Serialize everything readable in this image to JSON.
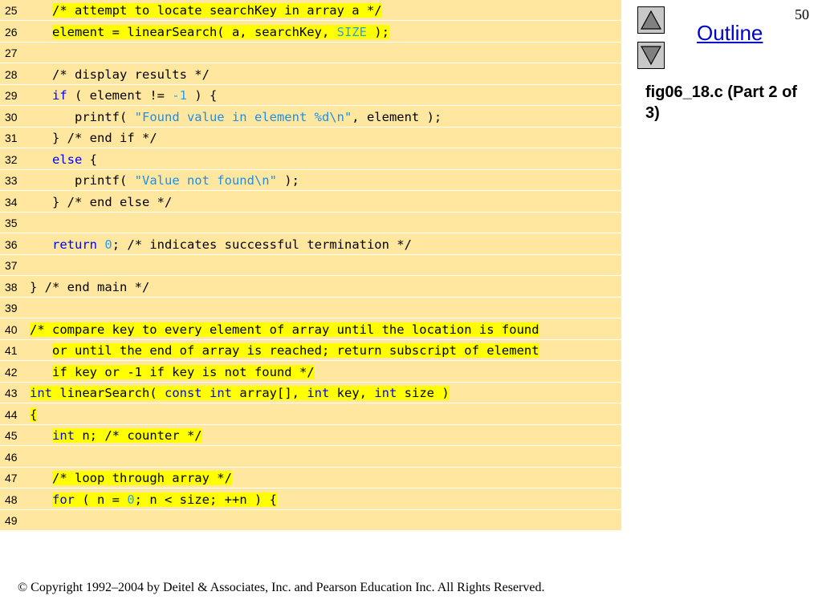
{
  "slide_number": "50",
  "outline_label": "Outline",
  "figure_caption": "fig06_18.c (Part 2 of 3)",
  "copyright": "© Copyright 1992–2004 by Deitel & Associates, Inc. and Pearson Education Inc. All Rights Reserved.",
  "nav": {
    "up_icon": "triangle-up-icon",
    "down_icon": "triangle-down-icon"
  },
  "colors": {
    "code_bg": "#ffe7a0",
    "highlight": "#ffff00",
    "keyword": "#0000ff",
    "literal": "#2a9df4"
  },
  "code_lines": [
    {
      "no": "25",
      "segs": [
        {
          "t": "   "
        },
        {
          "t": "/* attempt to locate searchKey in array a */",
          "c": "cmt",
          "h": true
        }
      ]
    },
    {
      "no": "26",
      "segs": [
        {
          "t": "   "
        },
        {
          "t": "element = linearSearch( a, searchKey, ",
          "h": true
        },
        {
          "t": "SIZE",
          "c": "num",
          "h": true
        },
        {
          "t": " );",
          "h": true
        }
      ]
    },
    {
      "no": "27",
      "segs": []
    },
    {
      "no": "28",
      "segs": [
        {
          "t": "   "
        },
        {
          "t": "/* display results */",
          "c": "cmt"
        }
      ]
    },
    {
      "no": "29",
      "segs": [
        {
          "t": "   "
        },
        {
          "t": "if",
          "c": "kw"
        },
        {
          "t": " ( element != "
        },
        {
          "t": "-1",
          "c": "num"
        },
        {
          "t": " ) {"
        }
      ]
    },
    {
      "no": "30",
      "segs": [
        {
          "t": "      printf( "
        },
        {
          "t": "\"Found value in element %d\\n\"",
          "c": "str"
        },
        {
          "t": ", element );"
        }
      ]
    },
    {
      "no": "31",
      "segs": [
        {
          "t": "   } "
        },
        {
          "t": "/* end if */",
          "c": "cmt"
        }
      ]
    },
    {
      "no": "32",
      "segs": [
        {
          "t": "   "
        },
        {
          "t": "else",
          "c": "kw"
        },
        {
          "t": " {"
        }
      ]
    },
    {
      "no": "33",
      "segs": [
        {
          "t": "      printf( "
        },
        {
          "t": "\"Value not found\\n\"",
          "c": "str"
        },
        {
          "t": " );"
        }
      ]
    },
    {
      "no": "34",
      "segs": [
        {
          "t": "   } "
        },
        {
          "t": "/* end else */",
          "c": "cmt"
        }
      ]
    },
    {
      "no": "35",
      "segs": []
    },
    {
      "no": "36",
      "segs": [
        {
          "t": "   "
        },
        {
          "t": "return",
          "c": "kw"
        },
        {
          "t": " "
        },
        {
          "t": "0",
          "c": "num"
        },
        {
          "t": "; "
        },
        {
          "t": "/* indicates successful termination */",
          "c": "cmt"
        }
      ]
    },
    {
      "no": "37",
      "segs": []
    },
    {
      "no": "38",
      "segs": [
        {
          "t": "} "
        },
        {
          "t": "/* end main */",
          "c": "cmt"
        }
      ]
    },
    {
      "no": "39",
      "segs": []
    },
    {
      "no": "40",
      "segs": [
        {
          "t": "/* compare key to every element of array until the location is found",
          "c": "cmt",
          "h": true
        }
      ]
    },
    {
      "no": "41",
      "segs": [
        {
          "t": "   "
        },
        {
          "t": "or until the end of array is reached; return subscript of element",
          "c": "cmt",
          "h": true
        }
      ]
    },
    {
      "no": "42",
      "segs": [
        {
          "t": "   "
        },
        {
          "t": "if key or -1 if key is not found */",
          "c": "cmt",
          "h": true
        }
      ]
    },
    {
      "no": "43",
      "segs": [
        {
          "t": "int",
          "c": "kw",
          "h": true
        },
        {
          "t": " linearSearch( ",
          "h": true
        },
        {
          "t": "const",
          "c": "kw",
          "h": true
        },
        {
          "t": " ",
          "h": true
        },
        {
          "t": "int",
          "c": "kw",
          "h": true
        },
        {
          "t": " array[], ",
          "h": true
        },
        {
          "t": "int",
          "c": "kw",
          "h": true
        },
        {
          "t": " key, ",
          "h": true
        },
        {
          "t": "int",
          "c": "kw",
          "h": true
        },
        {
          "t": " size )",
          "h": true
        }
      ]
    },
    {
      "no": "44",
      "segs": [
        {
          "t": "{",
          "h": true
        }
      ]
    },
    {
      "no": "45",
      "segs": [
        {
          "t": "   "
        },
        {
          "t": "int",
          "c": "kw",
          "h": true
        },
        {
          "t": " n; ",
          "h": true
        },
        {
          "t": "/* counter */",
          "c": "cmt",
          "h": true
        }
      ]
    },
    {
      "no": "46",
      "segs": []
    },
    {
      "no": "47",
      "segs": [
        {
          "t": "   "
        },
        {
          "t": "/* loop through array */",
          "c": "cmt",
          "h": true
        }
      ]
    },
    {
      "no": "48",
      "segs": [
        {
          "t": "   "
        },
        {
          "t": "for",
          "c": "kw",
          "h": true
        },
        {
          "t": " ( n = ",
          "h": true
        },
        {
          "t": "0",
          "c": "num",
          "h": true
        },
        {
          "t": "; n < size; ++n ) {",
          "h": true
        }
      ]
    },
    {
      "no": "49",
      "segs": []
    }
  ]
}
